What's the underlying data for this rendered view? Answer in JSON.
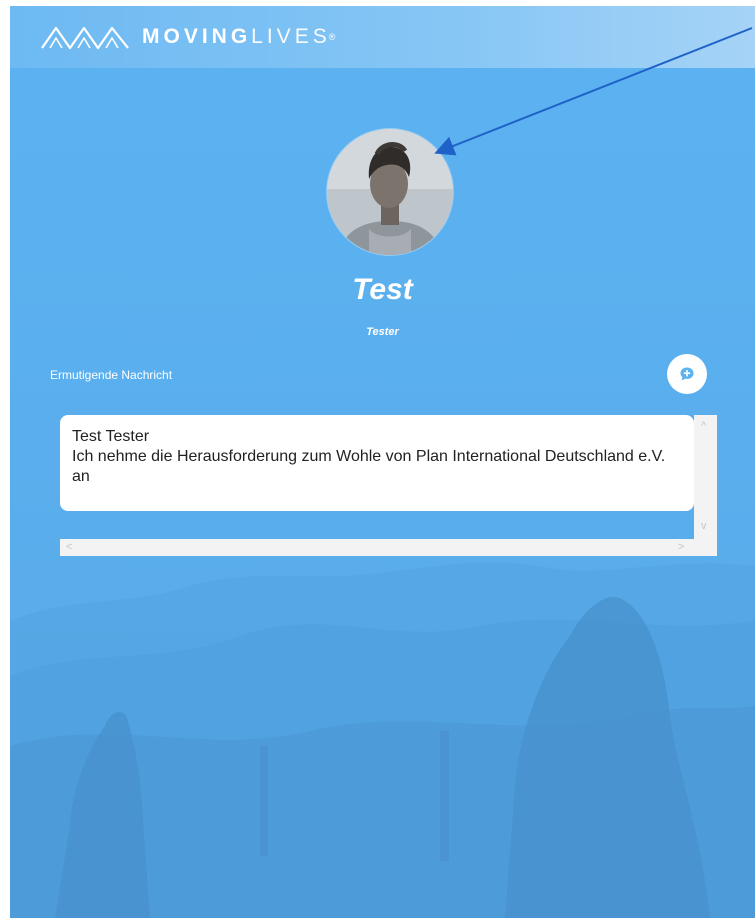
{
  "header": {
    "logo_bold": "MOVING",
    "logo_light": "LIVES",
    "logo_reg": "®"
  },
  "profile": {
    "name": "Test",
    "subtitle": "Tester",
    "avatar_icon": "profile-photo"
  },
  "message": {
    "label": "Ermutigende Nachricht",
    "text": "Test Tester\nIch nehme die Herausforderung zum Wohle von Plan International Deutschland e.V. an",
    "button_icon": "chat-bubble-icon"
  },
  "scrollbars": {
    "up": "^",
    "down": "v",
    "left": "<",
    "right": ">"
  },
  "colors": {
    "background": "#5cb2f1",
    "header": "#86c6f5",
    "accent": "#5aaeed",
    "annotation_arrow": "#1e62c8"
  }
}
